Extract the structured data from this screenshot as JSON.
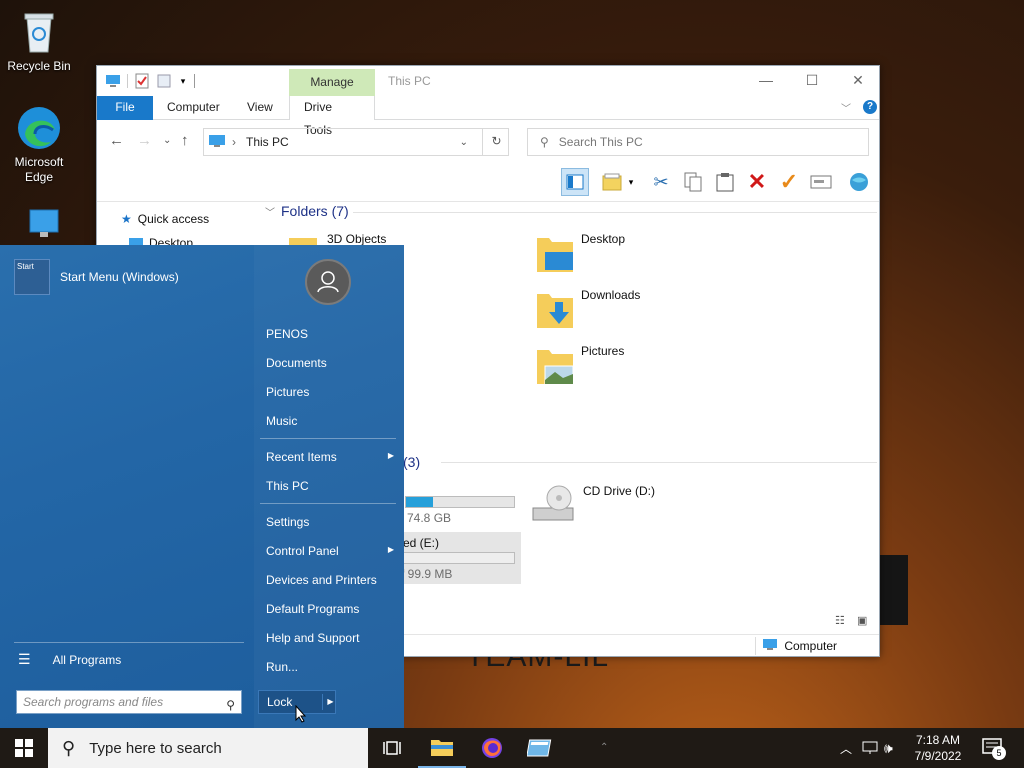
{
  "desktop": {
    "icons": [
      {
        "label_line1": "Recycle Bin",
        "label_line2": ""
      },
      {
        "label_line1": "Microsoft",
        "label_line2": "Edge"
      }
    ],
    "wallpaper_text": "TEAM-LIL"
  },
  "explorer": {
    "title": "This PC",
    "manage_tab": "Manage",
    "ribbon_tabs": [
      "File",
      "Computer",
      "View",
      "Drive Tools"
    ],
    "address": "This PC",
    "search_placeholder": "Search This PC",
    "nav": {
      "quick_access": "Quick access",
      "desktop": "Desktop"
    },
    "folders_header": "Folders (7)",
    "folders": [
      "3D Objects",
      "Desktop",
      "Downloads",
      "Pictures"
    ],
    "drives_header_count": "(3)",
    "drives": {
      "c_size": "74.8 GB",
      "e_label": "ed (E:)",
      "e_size": "f 99.9 MB",
      "cd_label": "CD Drive (D:)"
    },
    "status_computer": "Computer"
  },
  "start_menu": {
    "pinned_label": "Start Menu (Windows)",
    "pinned_icon_text": "Start",
    "all_programs": "All Programs",
    "search_placeholder": "Search programs and files",
    "right_items": {
      "user": "PENOS",
      "documents": "Documents",
      "pictures": "Pictures",
      "music": "Music",
      "recent": "Recent Items",
      "thispc": "This PC",
      "settings": "Settings",
      "control_panel": "Control Panel",
      "devices": "Devices and Printers",
      "default_programs": "Default Programs",
      "help": "Help and Support",
      "run": "Run..."
    },
    "lock": "Lock"
  },
  "taskbar": {
    "search_text": "Type here to search",
    "time": "7:18 AM",
    "date": "7/9/2022",
    "notification_count": "5"
  },
  "colors": {
    "start_menu_bg": "#2366a6",
    "file_tab": "#1979ca",
    "manage_tab": "#cfe9b8",
    "taskbar": "#1f1a15"
  }
}
